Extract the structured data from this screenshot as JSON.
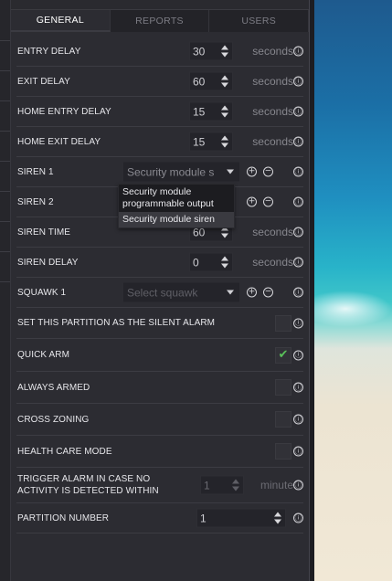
{
  "tabs": [
    {
      "label": "GENERAL",
      "active": true
    },
    {
      "label": "REPORTS",
      "active": false
    },
    {
      "label": "USERS",
      "active": false
    }
  ],
  "rows": {
    "entry_delay": {
      "label": "ENTRY DELAY",
      "value": "30",
      "unit": "seconds"
    },
    "exit_delay": {
      "label": "EXIT DELAY",
      "value": "60",
      "unit": "seconds"
    },
    "home_entry_delay": {
      "label": "HOME ENTRY DELAY",
      "value": "15",
      "unit": "seconds"
    },
    "home_exit_delay": {
      "label": "HOME EXIT DELAY",
      "value": "15",
      "unit": "seconds"
    },
    "siren_1": {
      "label": "SIREN 1",
      "selected": "Security module s"
    },
    "siren_2": {
      "label": "SIREN 2"
    },
    "siren_time": {
      "label": "SIREN TIME",
      "value": "60",
      "unit": "seconds"
    },
    "siren_delay": {
      "label": "SIREN DELAY",
      "value": "0",
      "unit": "seconds"
    },
    "squawk_1": {
      "label": "SQUAWK 1",
      "placeholder": "Select squawk"
    },
    "silent_alarm": {
      "label": "SET THIS PARTITION AS THE SILENT ALARM",
      "checked": false
    },
    "quick_arm": {
      "label": "QUICK ARM",
      "checked": true
    },
    "always_armed": {
      "label": "ALWAYS ARMED",
      "checked": false
    },
    "cross_zoning": {
      "label": "CROSS ZONING",
      "checked": false
    },
    "health_care_mode": {
      "label": "HEALTH CARE MODE",
      "checked": false
    },
    "trigger_alarm": {
      "label_line1": "TRIGGER ALARM IN CASE NO",
      "label_line2": "ACTIVITY IS DETECTED WITHIN",
      "value": "1",
      "unit": "minute"
    },
    "partition_number": {
      "label": "PARTITION NUMBER",
      "value": "1"
    }
  },
  "siren_dropdown": {
    "options": [
      {
        "line1": "Security module",
        "line2": "programmable output"
      },
      {
        "line1": "Security module siren",
        "line2": ""
      }
    ]
  },
  "icons": {
    "info": "ⓘ",
    "plus": "+",
    "minus": "−",
    "check": "✔"
  },
  "colors": {
    "panel_bg": "#2c2c32",
    "tab_bar_bg": "#232328",
    "check_green": "#5ac25a"
  }
}
